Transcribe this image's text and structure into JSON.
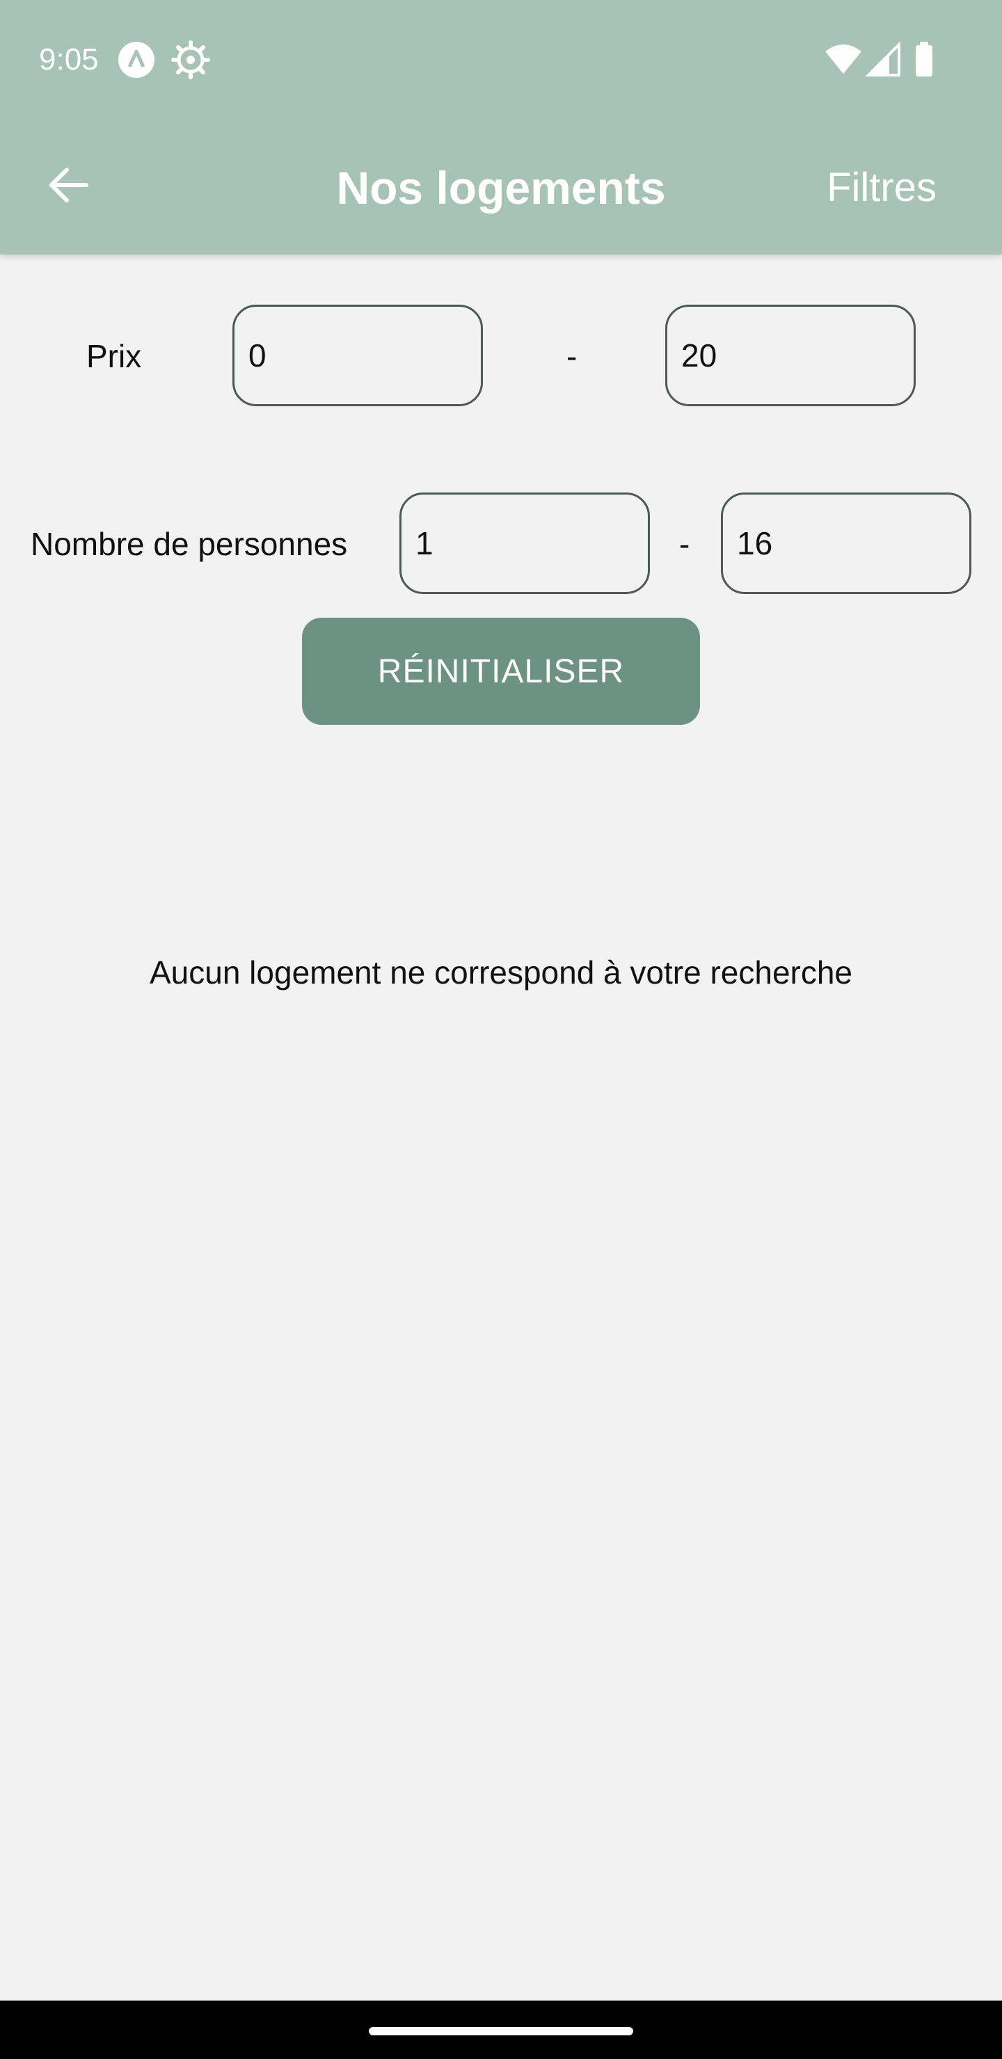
{
  "status_bar": {
    "time": "9:05",
    "icons": [
      "app-notification-icon",
      "settings-gear-icon",
      "wifi-icon",
      "cellular-signal-icon",
      "battery-icon"
    ]
  },
  "app_bar": {
    "title": "Nos logements",
    "filters_label": "Filtres",
    "back_icon": "arrow-left-icon"
  },
  "filters": {
    "price": {
      "label": "Prix",
      "min_value": "0",
      "separator": "-",
      "max_value": "20"
    },
    "people": {
      "label": "Nombre de personnes",
      "min_value": "1",
      "separator": "-",
      "max_value": "16"
    },
    "reset_label": "RÉINITIALISER"
  },
  "results": {
    "empty_message": "Aucun logement ne correspond à votre recherche"
  },
  "colors": {
    "header_bg": "#a6c3b5",
    "button_bg": "#6b9282",
    "page_bg": "#f2f2f2"
  }
}
